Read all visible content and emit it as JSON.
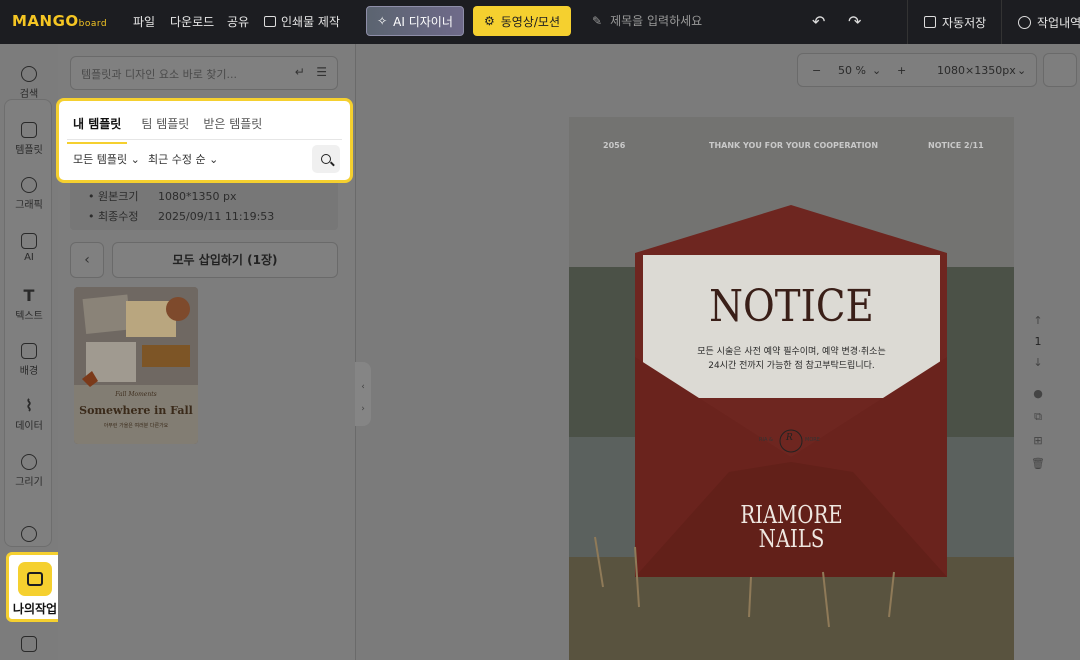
{
  "topbar": {
    "logo_main": "MANGO",
    "logo_sub": "board",
    "menu": [
      "파일",
      "다운로드",
      "공유",
      "인쇄물 제작"
    ],
    "ai_designer": "AI 디자이너",
    "video_motion": "동영상/모션",
    "title_placeholder": "제목을 입력하세요",
    "autosave": "자동저장",
    "history": "작업내역"
  },
  "rail": {
    "items": [
      "검색",
      "템플릿",
      "그래픽",
      "AI",
      "텍스트",
      "배경",
      "데이터",
      "그리기"
    ],
    "my_work": "나의작업"
  },
  "panel": {
    "search_placeholder": "템플릿과 디자인 요소 바로 찾기...",
    "tabs": [
      "내 템플릿",
      "팀 템플릿",
      "받은 템플릿"
    ],
    "filter_all": "모든 템플릿",
    "filter_sort": "최근 수정 순",
    "info_size_label": "원본크기",
    "info_size_value": "1080*1350 px",
    "info_modified_label": "최종수정",
    "info_modified_value": "2025/09/11 11:19:53",
    "insert_all": "모두 삽입하기 (1장)",
    "thumb_small": "Fall Moments",
    "thumb_title": "Somewhere in Fall",
    "thumb_sub": "아무런 가을은 여러분 다른가요"
  },
  "canvas": {
    "zoom": "50 %",
    "size": "1080×1350px",
    "page_number": "1",
    "design_left": "2056",
    "design_center": "THANK YOU FOR YOUR COOPERATION",
    "design_right": "NOTICE 2/11",
    "design_title": "NOTICE",
    "design_line1": "모든 시술은 사전 예약 필수이며, 예약 변경·취소는",
    "design_line2": "24시간 전까지 가능한 점 참고부탁드립니다.",
    "design_seal_left": "RIA &",
    "design_seal_right": "MORE",
    "design_seal_mark": "R",
    "design_brand1": "RIAMORE",
    "design_brand2": "NAILS"
  }
}
